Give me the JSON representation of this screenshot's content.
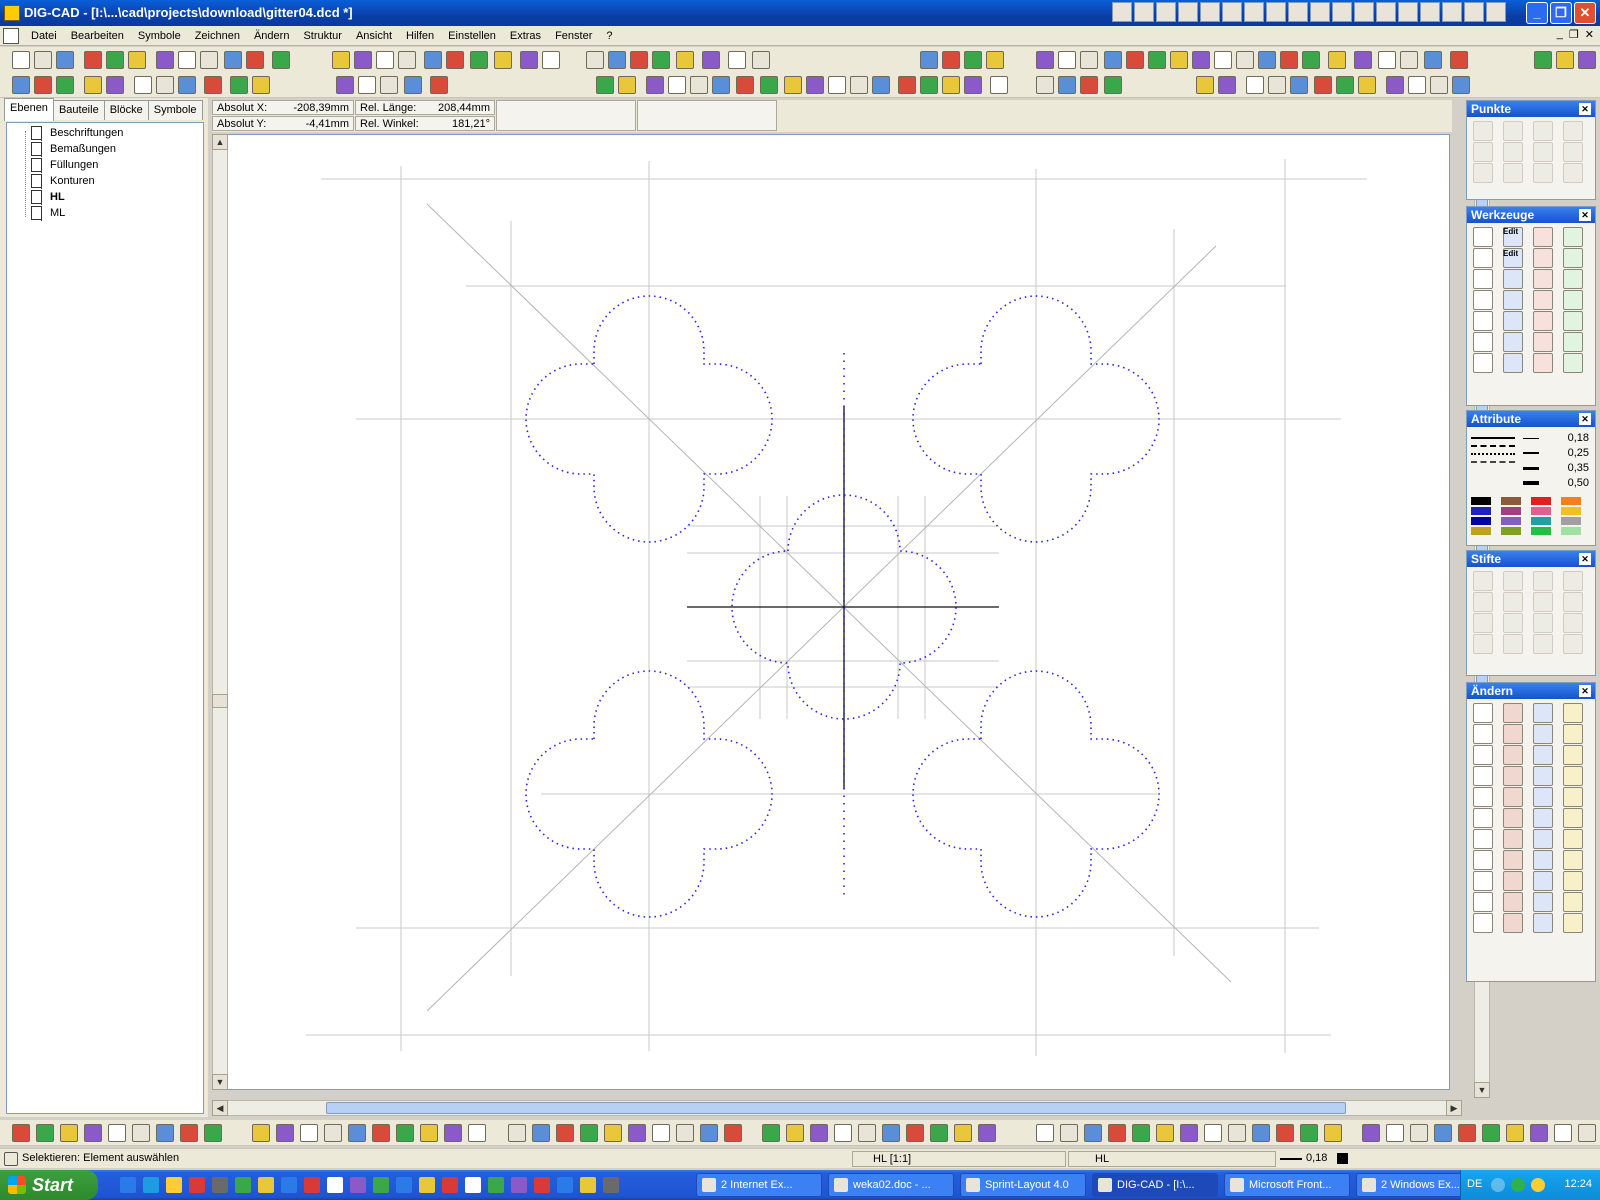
{
  "window": {
    "title": "DIG-CAD - [I:\\...\\cad\\projects\\download\\gitter04.dcd *]",
    "buttons": [
      "_",
      "❐",
      "✕"
    ]
  },
  "menu": {
    "items": [
      "Datei",
      "Bearbeiten",
      "Symbole",
      "Zeichnen",
      "Ändern",
      "Struktur",
      "Ansicht",
      "Hilfen",
      "Einstellen",
      "Extras",
      "Fenster",
      "?"
    ],
    "mdi_buttons": [
      "_",
      "❐",
      "✕"
    ]
  },
  "left_panel": {
    "tabs": [
      "Ebenen",
      "Bauteile",
      "Blöcke",
      "Symbole"
    ],
    "active_tab": "Ebenen",
    "layers": [
      {
        "name": "Beschriftungen",
        "bold": false
      },
      {
        "name": "Bemaßungen",
        "bold": false
      },
      {
        "name": "Füllungen",
        "bold": false
      },
      {
        "name": "Konturen",
        "bold": false
      },
      {
        "name": "HL",
        "bold": true
      },
      {
        "name": "ML",
        "bold": false
      }
    ]
  },
  "coords": {
    "absolut_x_label": "Absolut X:",
    "absolut_x": "-208,39mm",
    "absolut_y_label": "Absolut Y:",
    "absolut_y": "-4,41mm",
    "rel_laenge_label": "Rel. Länge:",
    "rel_laenge": "208,44mm",
    "rel_winkel_label": "Rel. Winkel:",
    "rel_winkel": "181,21°"
  },
  "palettes": {
    "punkte": "Punkte",
    "werkzeuge": "Werkzeuge",
    "edit1": "Edit",
    "edit2": "Edit",
    "attribute": "Attribute",
    "line_widths": [
      "0,18",
      "0,25",
      "0,35",
      "0,50"
    ],
    "colors": [
      "#000000",
      "#8b5a3c",
      "#e02020",
      "#f08020",
      "#2020c0",
      "#a04080",
      "#e06090",
      "#f0c020",
      "#0000a0",
      "#8060c0",
      "#20a0a0",
      "#a0a0a0",
      "#c0a020",
      "#80a020",
      "#20c040",
      "#a0e0a0"
    ],
    "stifte": "Stifte",
    "aendern": "Ändern"
  },
  "status": {
    "message": "Selektieren: Element auswählen",
    "layer": "HL [1:1]",
    "pen_layer": "HL",
    "line_width": "0,18"
  },
  "taskbar": {
    "start": "Start",
    "tasks": [
      {
        "label": "2 Internet Ex...",
        "active": false
      },
      {
        "label": "weka02.doc - ...",
        "active": false
      },
      {
        "label": "Sprint-Layout 4.0",
        "active": false
      },
      {
        "label": "DIG-CAD - [I:\\...",
        "active": true
      },
      {
        "label": "Microsoft Front...",
        "active": false
      },
      {
        "label": "2 Windows Ex...",
        "active": false
      }
    ],
    "language": "DE",
    "clock": "12:24"
  },
  "colors": {
    "grid_line": "#c8c8c8",
    "diag_line": "#b4b4b4",
    "axis_line": "#101010",
    "dotted_outline": "#2222ee"
  }
}
